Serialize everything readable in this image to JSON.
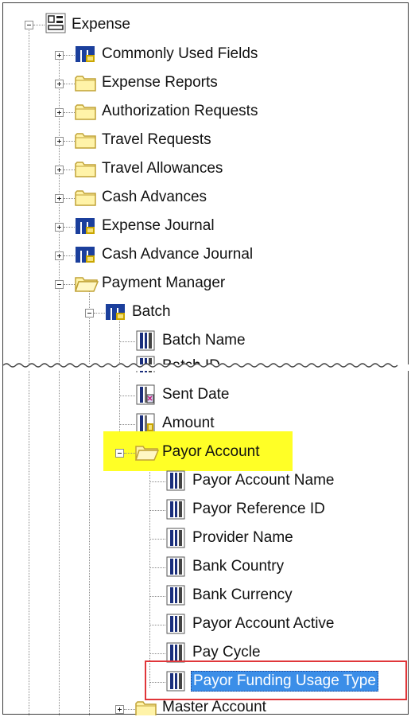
{
  "tree": {
    "root": {
      "label": "Expense",
      "icon": "subject-area-icon"
    },
    "level1": [
      {
        "label": "Commonly Used Fields",
        "icon": "table-icon",
        "expander": "plus"
      },
      {
        "label": "Expense Reports",
        "icon": "folder-icon",
        "expander": "plus"
      },
      {
        "label": "Authorization Requests",
        "icon": "folder-icon",
        "expander": "plus"
      },
      {
        "label": "Travel Requests",
        "icon": "folder-icon",
        "expander": "plus"
      },
      {
        "label": "Travel Allowances",
        "icon": "folder-icon",
        "expander": "plus"
      },
      {
        "label": "Cash Advances",
        "icon": "folder-icon",
        "expander": "plus"
      },
      {
        "label": "Expense Journal",
        "icon": "table-icon",
        "expander": "plus"
      },
      {
        "label": "Cash Advance Journal",
        "icon": "table-icon",
        "expander": "plus"
      },
      {
        "label": "Payment Manager",
        "icon": "open-folder-icon",
        "expander": "minus"
      }
    ],
    "batch": {
      "label": "Batch",
      "icon": "table-icon"
    },
    "batch_fields": [
      {
        "label": "Batch Name",
        "icon": "attribute-icon"
      },
      {
        "label": "Batch ID",
        "icon": "attribute-icon"
      },
      {
        "label": "Sent Date",
        "icon": "date-icon"
      },
      {
        "label": "Amount",
        "icon": "measure-icon"
      }
    ],
    "payor_account": {
      "label": "Payor Account",
      "icon": "open-folder-icon",
      "highlighted": true
    },
    "payor_fields": [
      {
        "label": "Payor Account Name",
        "icon": "attribute-icon"
      },
      {
        "label": "Payor Reference ID",
        "icon": "attribute-icon"
      },
      {
        "label": "Provider Name",
        "icon": "attribute-icon"
      },
      {
        "label": "Bank Country",
        "icon": "attribute-icon"
      },
      {
        "label": "Bank Currency",
        "icon": "attribute-icon"
      },
      {
        "label": "Payor Account Active",
        "icon": "attribute-icon"
      },
      {
        "label": "Pay Cycle",
        "icon": "attribute-icon"
      },
      {
        "label": "Payor Funding Usage Type",
        "icon": "attribute-icon",
        "selected": true
      }
    ],
    "master_account": {
      "label": "Master Account",
      "icon": "folder-icon",
      "expander": "plus"
    }
  },
  "colors": {
    "highlight": "#ffff26",
    "selection": "#3b8ee8",
    "callout": "#e0363a"
  }
}
